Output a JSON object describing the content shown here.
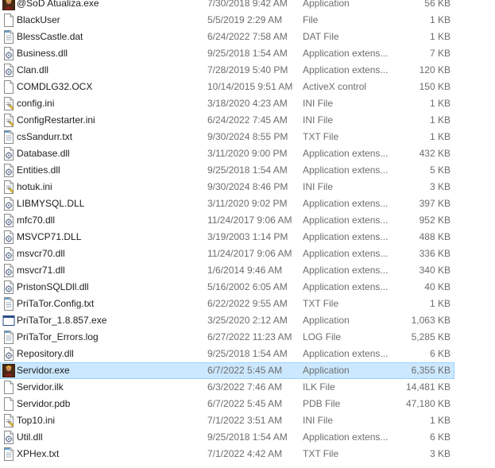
{
  "files": [
    {
      "name": "@SoD Atualiza.exe",
      "date": "7/30/2018 9:42 AM",
      "type": "Application",
      "size": "56 KB",
      "icon": "app-avatar-icon"
    },
    {
      "name": "BlackUser",
      "date": "5/5/2019 2:29 AM",
      "type": "File",
      "size": "1 KB",
      "icon": "blank-file-icon"
    },
    {
      "name": "BlessCastle.dat",
      "date": "6/24/2022 7:58 AM",
      "type": "DAT File",
      "size": "1 KB",
      "icon": "notepad-file-icon"
    },
    {
      "name": "Business.dll",
      "date": "9/25/2018 1:54 AM",
      "type": "Application extens...",
      "size": "7 KB",
      "icon": "dll-file-icon"
    },
    {
      "name": "Clan.dll",
      "date": "7/28/2019 5:40 PM",
      "type": "Application extens...",
      "size": "120 KB",
      "icon": "dll-file-icon"
    },
    {
      "name": "COMDLG32.OCX",
      "date": "10/14/2015 9:51 AM",
      "type": "ActiveX control",
      "size": "150 KB",
      "icon": "blank-file-icon"
    },
    {
      "name": "config.ini",
      "date": "3/18/2020 4:23 AM",
      "type": "INI File",
      "size": "1 KB",
      "icon": "ini-file-icon"
    },
    {
      "name": "ConfigRestarter.ini",
      "date": "6/24/2022 7:45 AM",
      "type": "INI File",
      "size": "1 KB",
      "icon": "ini-file-icon"
    },
    {
      "name": "csSandurr.txt",
      "date": "9/30/2024 8:55 PM",
      "type": "TXT File",
      "size": "1 KB",
      "icon": "notepad-file-icon"
    },
    {
      "name": "Database.dll",
      "date": "3/11/2020 9:00 PM",
      "type": "Application extens...",
      "size": "432 KB",
      "icon": "dll-file-icon"
    },
    {
      "name": "Entities.dll",
      "date": "9/25/2018 1:54 AM",
      "type": "Application extens...",
      "size": "5 KB",
      "icon": "dll-file-icon"
    },
    {
      "name": "hotuk.ini",
      "date": "9/30/2024 8:46 PM",
      "type": "INI File",
      "size": "3 KB",
      "icon": "ini-file-icon"
    },
    {
      "name": "LIBMYSQL.DLL",
      "date": "3/11/2020 9:02 PM",
      "type": "Application extens...",
      "size": "397 KB",
      "icon": "dll-file-icon"
    },
    {
      "name": "mfc70.dll",
      "date": "11/24/2017 9:06 AM",
      "type": "Application extens...",
      "size": "952 KB",
      "icon": "dll-file-icon"
    },
    {
      "name": "MSVCP71.DLL",
      "date": "3/19/2003 1:14 PM",
      "type": "Application extens...",
      "size": "488 KB",
      "icon": "dll-file-icon"
    },
    {
      "name": "msvcr70.dll",
      "date": "11/24/2017 9:06 AM",
      "type": "Application extens...",
      "size": "336 KB",
      "icon": "dll-file-icon"
    },
    {
      "name": "msvcr71.dll",
      "date": "1/6/2014 9:46 AM",
      "type": "Application extens...",
      "size": "340 KB",
      "icon": "dll-file-icon"
    },
    {
      "name": "PristonSQLDll.dll",
      "date": "5/16/2002 6:05 AM",
      "type": "Application extens...",
      "size": "40 KB",
      "icon": "dll-file-icon"
    },
    {
      "name": "PriTaTor.Config.txt",
      "date": "6/22/2022 9:55 AM",
      "type": "TXT File",
      "size": "1 KB",
      "icon": "notepad-file-icon"
    },
    {
      "name": "PriTaTor_1.8.857.exe",
      "date": "3/25/2020 2:12 AM",
      "type": "Application",
      "size": "1,063 KB",
      "icon": "exe-window-icon"
    },
    {
      "name": "PriTaTor_Errors.log",
      "date": "6/27/2022 11:23 AM",
      "type": "LOG File",
      "size": "5,285 KB",
      "icon": "notepad-file-icon"
    },
    {
      "name": "Repository.dll",
      "date": "9/25/2018 1:54 AM",
      "type": "Application extens...",
      "size": "6 KB",
      "icon": "dll-file-icon"
    },
    {
      "name": "Servidor.exe",
      "date": "6/7/2022 5:45 AM",
      "type": "Application",
      "size": "6,355 KB",
      "icon": "app-avatar-icon",
      "selected": true
    },
    {
      "name": "Servidor.ilk",
      "date": "6/3/2022 7:46 AM",
      "type": "ILK File",
      "size": "14,481 KB",
      "icon": "blank-file-icon"
    },
    {
      "name": "Servidor.pdb",
      "date": "6/7/2022 5:45 AM",
      "type": "PDB File",
      "size": "47,180 KB",
      "icon": "blank-file-icon"
    },
    {
      "name": "Top10.ini",
      "date": "7/1/2022 3:51 AM",
      "type": "INI File",
      "size": "1 KB",
      "icon": "ini-file-icon"
    },
    {
      "name": "Util.dll",
      "date": "9/25/2018 1:54 AM",
      "type": "Application extens...",
      "size": "6 KB",
      "icon": "dll-file-icon"
    },
    {
      "name": "XPHex.txt",
      "date": "7/1/2022 4:42 AM",
      "type": "TXT File",
      "size": "3 KB",
      "icon": "notepad-file-icon"
    }
  ],
  "colors": {
    "selection_bg": "#cce8ff",
    "selection_border": "#99d1ff",
    "name_text": "#1e1e1e",
    "detail_text": "#6d6d6d"
  }
}
